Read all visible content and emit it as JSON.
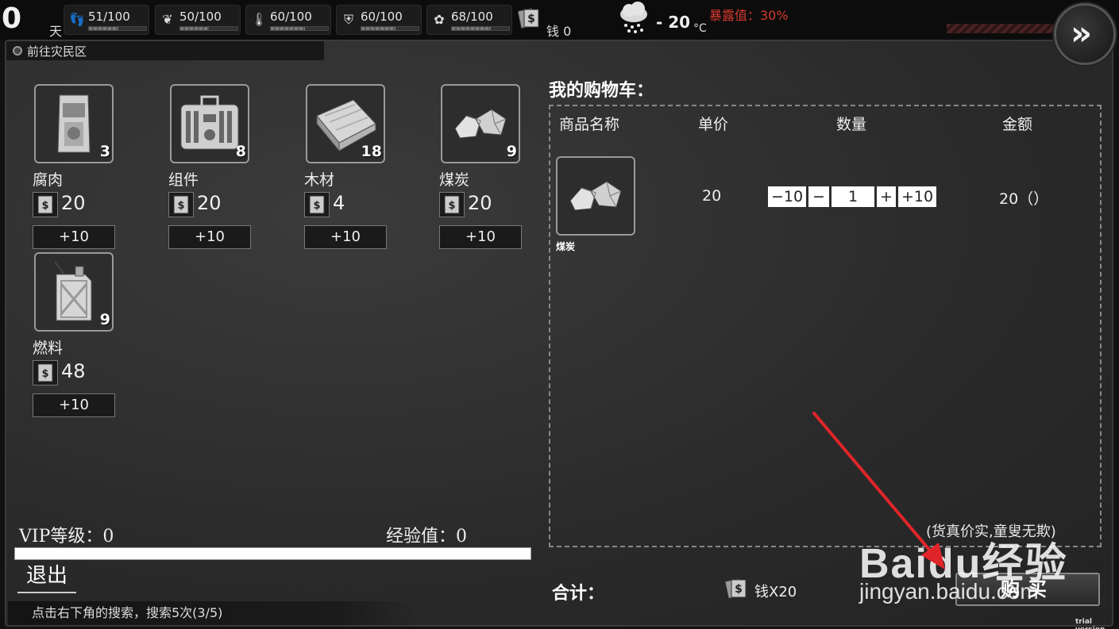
{
  "hud": {
    "day": "0",
    "day_label": "天",
    "stats": [
      {
        "icon": "footprint-icon",
        "value": "51/100",
        "level": 0.51
      },
      {
        "icon": "stomach-icon",
        "value": "50/100",
        "level": 0.5
      },
      {
        "icon": "thermometer-icon",
        "value": "60/100",
        "level": 0.6
      },
      {
        "icon": "health-shield-icon",
        "value": "60/100",
        "level": 0.6
      },
      {
        "icon": "mood-icon",
        "value": "68/100",
        "level": 0.68
      }
    ],
    "money": "钱 0",
    "weather_icon": "snow-cloud-icon",
    "temperature": "- 20",
    "temperature_unit": "°C",
    "exposure": "暴露值：30%",
    "exposure_color": "#d43a2e",
    "next_label": "»"
  },
  "location": "前往灾民区",
  "shop": {
    "items": [
      {
        "name": "腐肉",
        "count": "3",
        "price": "20",
        "button": "+10",
        "icon": "meat-bag-icon"
      },
      {
        "name": "组件",
        "count": "8",
        "price": "20",
        "button": "+10",
        "icon": "toolbox-icon"
      },
      {
        "name": "木材",
        "count": "18",
        "price": "4",
        "button": "+10",
        "icon": "wood-plank-icon"
      },
      {
        "name": "煤炭",
        "count": "9",
        "price": "20",
        "button": "+10",
        "icon": "coal-icon"
      },
      {
        "name": "燃料",
        "count": "9",
        "price": "48",
        "button": "+10",
        "icon": "fuel-can-icon"
      }
    ]
  },
  "vip": {
    "label": "VIP等级：0",
    "exp": "经验值：0",
    "progress": 1.0
  },
  "exit_label": "退出",
  "hint": "点击右下角的搜索，搜索5次(3/5)",
  "cart": {
    "title": "我的购物车：",
    "columns": [
      "商品名称",
      "单价",
      "数量",
      "金额"
    ],
    "row": {
      "name": "煤炭",
      "unit_price": "20",
      "minus10": "−10",
      "minus1": "−",
      "quantity": "1",
      "plus1": "+",
      "plus10": "+10",
      "amount": "20（）"
    },
    "slogan": "(货真价实,童叟无欺)"
  },
  "total": {
    "label": "合计：",
    "value": "钱X20"
  },
  "buy_label": "购买",
  "trial": "trial version",
  "watermark": {
    "logo": "Baidu经验",
    "sub": "jingyan.baidu.com"
  }
}
